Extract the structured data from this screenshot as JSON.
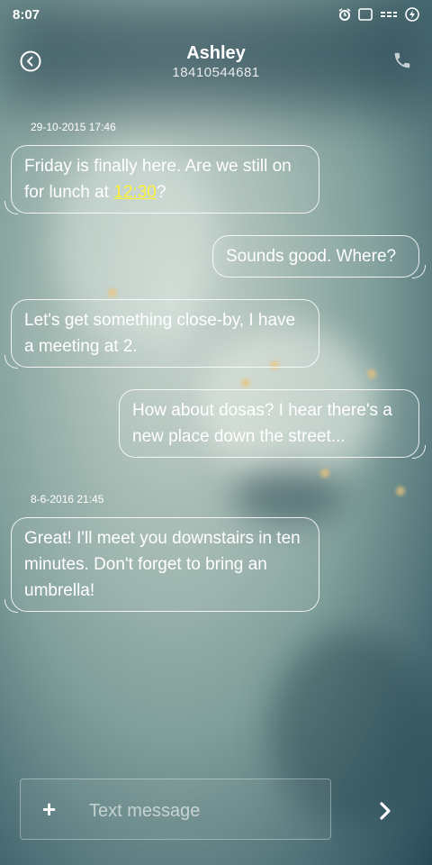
{
  "status_bar": {
    "time": "8:07",
    "icons": [
      "alarm-icon",
      "screen-icon",
      "signal-icon",
      "battery-charging-icon"
    ]
  },
  "header": {
    "contact_name": "Ashley",
    "contact_number": "18410544681",
    "back_icon": "back-icon",
    "call_icon": "phone-icon"
  },
  "conversation": {
    "timestamps": [
      "29-10-2015 17:46",
      "8-6-2016 21:45"
    ],
    "messages": [
      {
        "direction": "in",
        "before": "Friday is finally here. Are we still on for lunch at ",
        "link": "12:30",
        "after": "?"
      },
      {
        "direction": "out",
        "text": "Sounds good. Where?"
      },
      {
        "direction": "in",
        "text": "Let's get something close-by, I have a meeting at 2."
      },
      {
        "direction": "out",
        "text": "How about dosas? I hear there's a new place down the street..."
      },
      {
        "direction": "in",
        "text": "Great! I'll meet you downstairs in ten minutes. Don't forget to bring an umbrella!"
      }
    ]
  },
  "composer": {
    "plus_label": "+",
    "placeholder": "Text message",
    "value": "",
    "send_icon": "chevron-right-icon"
  },
  "colors": {
    "link": "#fbf23a",
    "bubble_border": "#ffffff"
  }
}
